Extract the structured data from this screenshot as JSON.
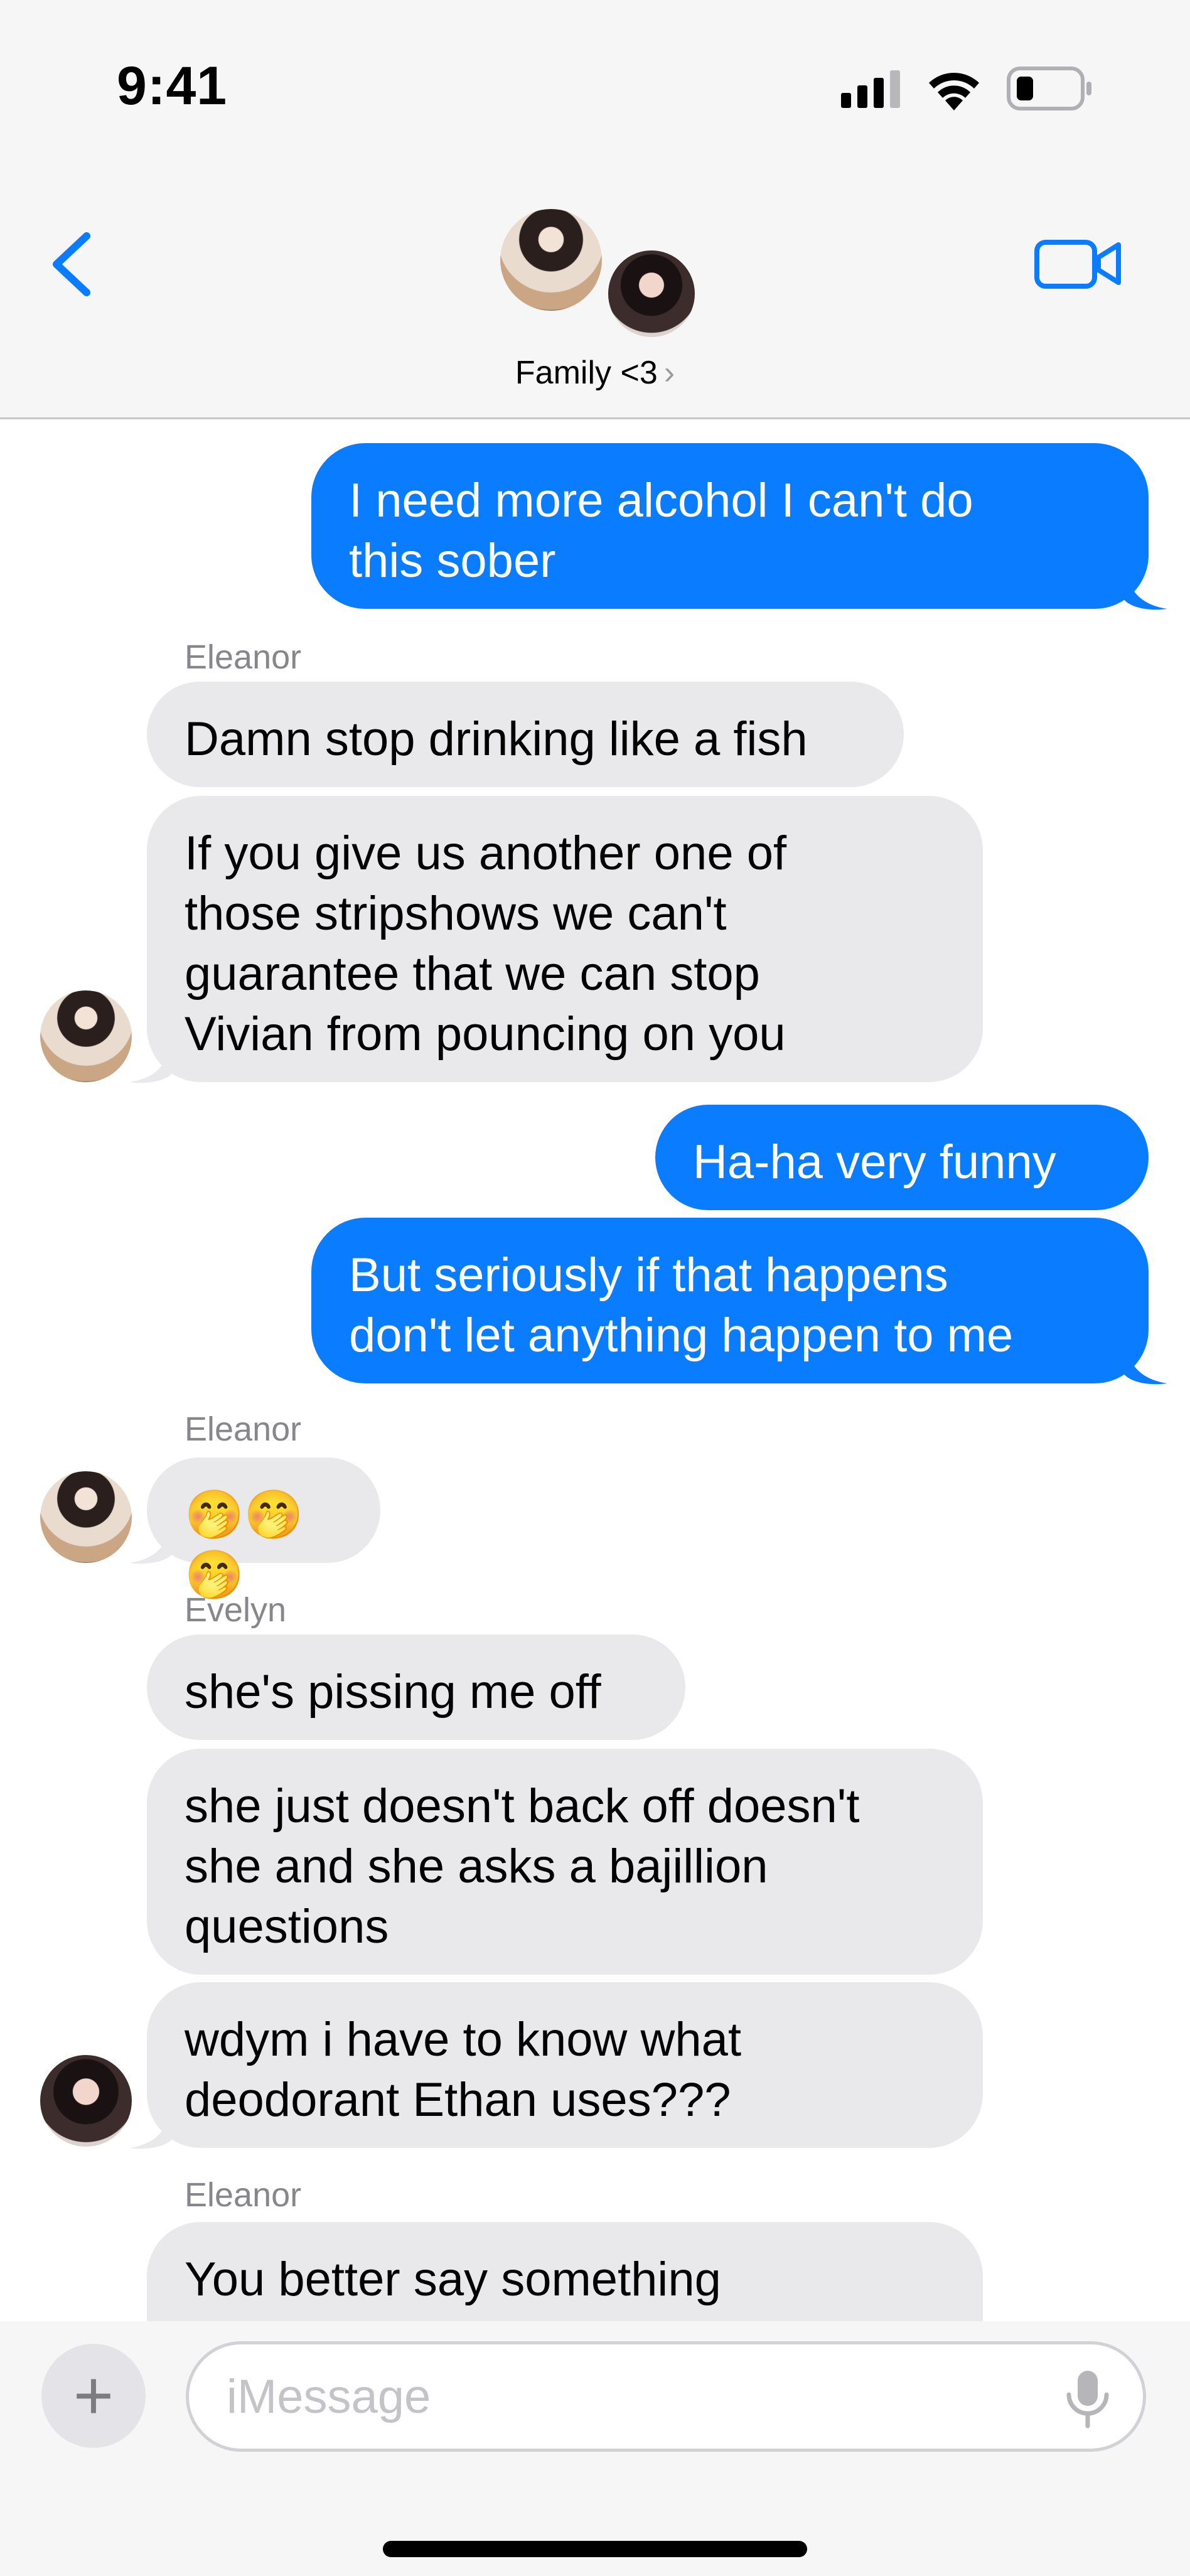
{
  "status_bar": {
    "time": "9:41"
  },
  "header": {
    "group_name": "Family <3",
    "chevron": "›",
    "back_icon": "chevron-left-icon",
    "video_icon": "video-camera-icon"
  },
  "colors": {
    "accent": "#0a7cff",
    "incoming": "#e9e9eb",
    "sender_label": "#86868b"
  },
  "messages": [
    {
      "direction": "out",
      "text": "I need more alcohol I can't do\nthis sober"
    },
    {
      "direction": "in",
      "sender": "Eleanor",
      "text": "Damn stop drinking like a fish"
    },
    {
      "direction": "in",
      "text": "If you give us another one of\nthose stripshows we can't\nguarantee that we can stop\nVivian from pouncing on you"
    },
    {
      "direction": "out",
      "text": "Ha-ha very funny"
    },
    {
      "direction": "out",
      "text": "But seriously if that happens\ndon't let anything happen to me"
    },
    {
      "direction": "in",
      "sender": "Eleanor",
      "text": "🤭🤭🤭"
    },
    {
      "direction": "in",
      "sender": "Evelyn",
      "text": "she's pissing me off"
    },
    {
      "direction": "in",
      "text": "she just doesn't back off doesn't\nshe and she asks a bajillion\nquestions"
    },
    {
      "direction": "in",
      "text": "wdym i have to know what\ndeodorant Ethan uses???"
    },
    {
      "direction": "in",
      "sender": "Eleanor",
      "text": "You better say something"
    }
  ],
  "compose": {
    "placeholder": "iMessage",
    "plus_label": "+",
    "mic_icon": "microphone-icon"
  }
}
